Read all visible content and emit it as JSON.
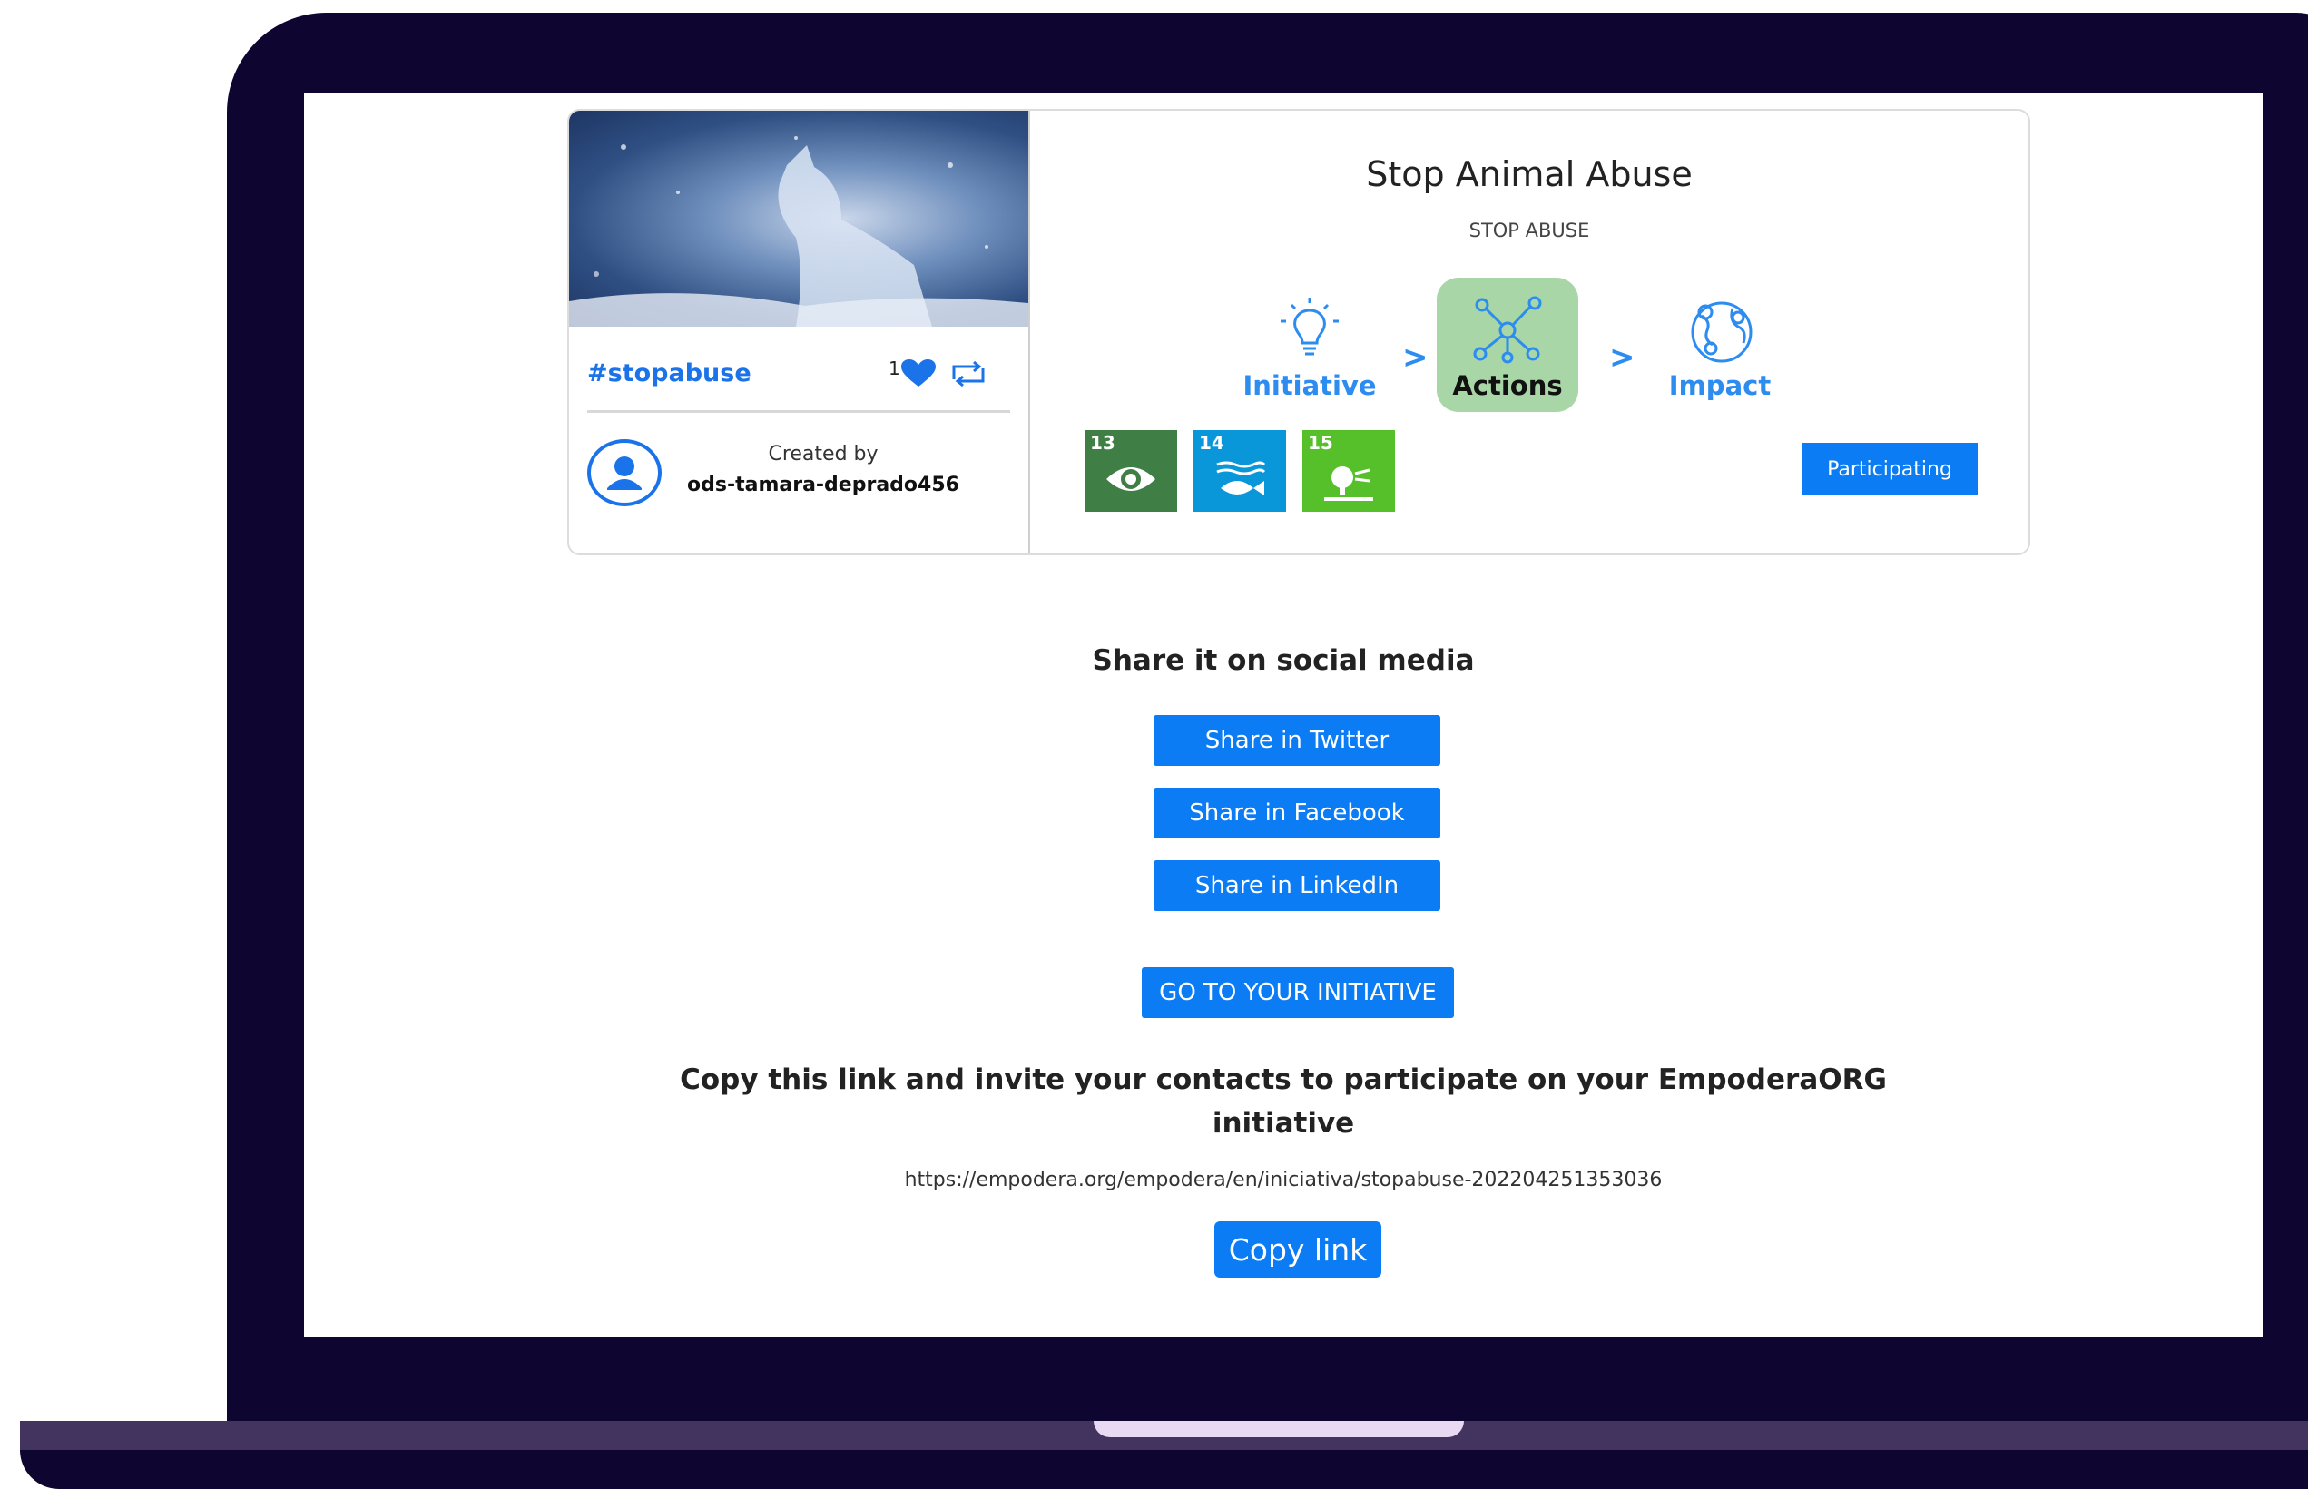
{
  "card": {
    "hashtag": "#stopabuse",
    "likes": "1",
    "created_by_label": "Created by",
    "creator": "ods-tamara-deprado456",
    "title": "Stop Animal Abuse",
    "subtitle": "STOP ABUSE",
    "stages": [
      {
        "label": "Initiative",
        "icon": "lightbulb-icon",
        "active": false
      },
      {
        "label": "Actions",
        "icon": "network-icon",
        "active": true
      },
      {
        "label": "Impact",
        "icon": "globe-icon",
        "active": false
      }
    ],
    "stage_separator": ">",
    "sdg_goals": [
      {
        "number": "13",
        "color": "#3f7e44",
        "icon": "eye-globe-icon"
      },
      {
        "number": "14",
        "color": "#0a97d9",
        "icon": "fish-icon"
      },
      {
        "number": "15",
        "color": "#56c02b",
        "icon": "tree-icon"
      }
    ],
    "participating_label": "Participating"
  },
  "share": {
    "heading": "Share it on social media",
    "twitter_label": "Share in Twitter",
    "facebook_label": "Share in Facebook",
    "linkedin_label": "Share in LinkedIn"
  },
  "go_initiative_label": "GO TO YOUR INITIATIVE",
  "invite": {
    "text": "Copy this link and invite your contacts to participate on your EmpoderaORG initiative",
    "url": "https://empodera.org/empodera/en/iniciativa/stopabuse-202204251353036",
    "copy_label": "Copy link"
  },
  "colors": {
    "accent": "#0b7cf4",
    "laptop_frame": "#0e0530",
    "actions_highlight": "#a8d6a6"
  }
}
